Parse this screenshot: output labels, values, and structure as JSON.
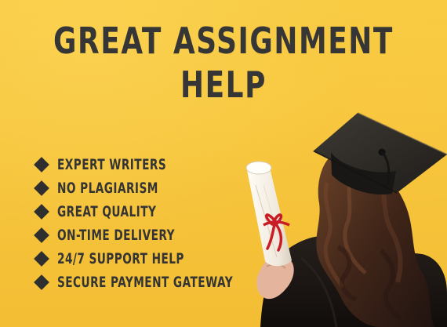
{
  "headline": {
    "line1": "GREAT ASSIGNMENT",
    "line2": "HELP"
  },
  "features": [
    "EXPERT WRITERS",
    "NO PLAGIARISM",
    "GREAT QUALITY",
    "ON-TIME DELIVERY",
    "24/7 SUPPORT HELP",
    "SECURE PAYMENT GATEWAY"
  ],
  "colors": {
    "background": "#f6c63c",
    "text": "#363636",
    "cap": "#2b2a27",
    "hair": "#3a2418",
    "gown": "#17120f",
    "ribbon": "#c81d25",
    "diploma": "#f8f3eb"
  },
  "illustration": {
    "subject": "graduate-with-diploma",
    "cap_icon": "mortarboard-icon",
    "diploma_icon": "rolled-diploma-icon",
    "bullet_icon": "diamond-bullet-icon"
  }
}
